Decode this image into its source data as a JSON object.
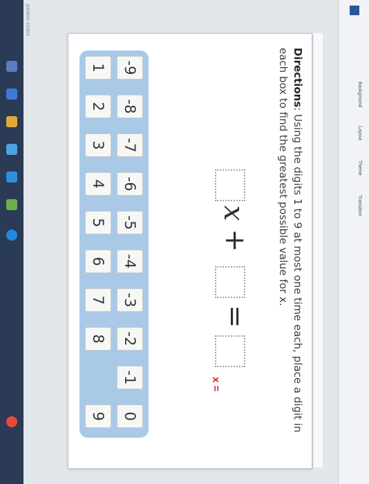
{
  "ribbon": {
    "labels": [
      "Background",
      "Layout",
      "Theme",
      "Transition"
    ]
  },
  "sidebar": {
    "speaker_notes": "peaker notes"
  },
  "directions": {
    "bold": "Directions",
    "text": ": Using the digits 1 to 9 at most one time each, place a digit in each box to find the greatest possible value for x."
  },
  "equation": {
    "var": "x",
    "plus": "+",
    "equals": "=",
    "answer_label": "x ="
  },
  "tiles": {
    "negatives": [
      "-9",
      "-8",
      "-7",
      "-6",
      "-5",
      "-4",
      "-3",
      "-2",
      "-1",
      "0"
    ],
    "positives": [
      "1",
      "2",
      "3",
      "4",
      "5",
      "6",
      "7",
      "8",
      "9"
    ]
  }
}
